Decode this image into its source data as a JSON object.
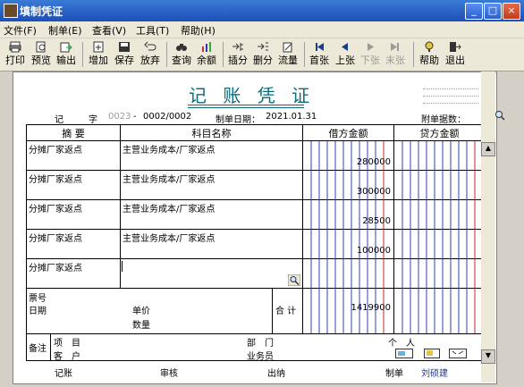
{
  "window": {
    "title": "填制凭证"
  },
  "menu": [
    {
      "label": "文件(F)"
    },
    {
      "label": "制单(E)"
    },
    {
      "label": "查看(V)"
    },
    {
      "label": "工具(T)"
    },
    {
      "label": "帮助(H)"
    }
  ],
  "toolbar": [
    {
      "label": "打印",
      "icon": "printer-icon"
    },
    {
      "label": "预览",
      "icon": "preview-icon"
    },
    {
      "label": "输出",
      "icon": "export-icon"
    },
    {
      "label": "增加",
      "icon": "add-icon"
    },
    {
      "label": "保存",
      "icon": "save-icon"
    },
    {
      "label": "放弃",
      "icon": "undo-icon"
    },
    {
      "label": "查询",
      "icon": "binoculars-icon"
    },
    {
      "label": "余额",
      "icon": "bar-chart-icon"
    },
    {
      "label": "插分",
      "icon": "insert-row-icon"
    },
    {
      "label": "删分",
      "icon": "delete-row-icon"
    },
    {
      "label": "流量",
      "icon": "flow-icon"
    },
    {
      "label": "首张",
      "icon": "first-icon"
    },
    {
      "label": "上张",
      "icon": "prev-icon"
    },
    {
      "label": "下张",
      "icon": "next-icon",
      "disabled": true
    },
    {
      "label": "末张",
      "icon": "last-icon",
      "disabled": true
    },
    {
      "label": "帮助",
      "icon": "help-icon"
    },
    {
      "label": "退出",
      "icon": "exit-icon"
    }
  ],
  "voucher": {
    "title": "记 账 凭 证",
    "type_label": "记",
    "zi_label": "字",
    "no_prefix": "0023",
    "dash": "-",
    "no": "0002/0002",
    "date_label": "制单日期：",
    "date": "2021.01.31",
    "attach_label": "附单据数："
  },
  "columns": {
    "summary": "摘 要",
    "account": "科目名称",
    "debit": "借方金额",
    "credit": "贷方金额"
  },
  "rows": [
    {
      "summary": "分摊厂家返点",
      "account": "主营业务成本/厂家返点",
      "debit": "280000",
      "credit": ""
    },
    {
      "summary": "分摊厂家返点",
      "account": "主营业务成本/厂家返点",
      "debit": "300000",
      "credit": ""
    },
    {
      "summary": "分摊厂家返点",
      "account": "主营业务成本/厂家返点",
      "debit": "28500",
      "credit": ""
    },
    {
      "summary": "分摊厂家返点",
      "account": "主营业务成本/厂家返点",
      "debit": "100000",
      "credit": ""
    },
    {
      "summary": "分摊厂家返点",
      "account": "",
      "debit": "",
      "credit": ""
    }
  ],
  "footer": {
    "ticket_label": "票号",
    "date_label": "日期",
    "price_label": "单价",
    "qty_label": "数量",
    "total_label": "合 计",
    "total_amount": "1419900",
    "remark_label": "备注",
    "project_label": "项　目",
    "dept_label": "部　门",
    "person_label": "个　人",
    "customer_label": "客　户",
    "salesman_label": "业务员"
  },
  "signatures": {
    "bookkeeping": "记账",
    "audit": "审核",
    "cashier": "出纳",
    "maker_label": "制单",
    "maker_name": "刘硕建"
  }
}
